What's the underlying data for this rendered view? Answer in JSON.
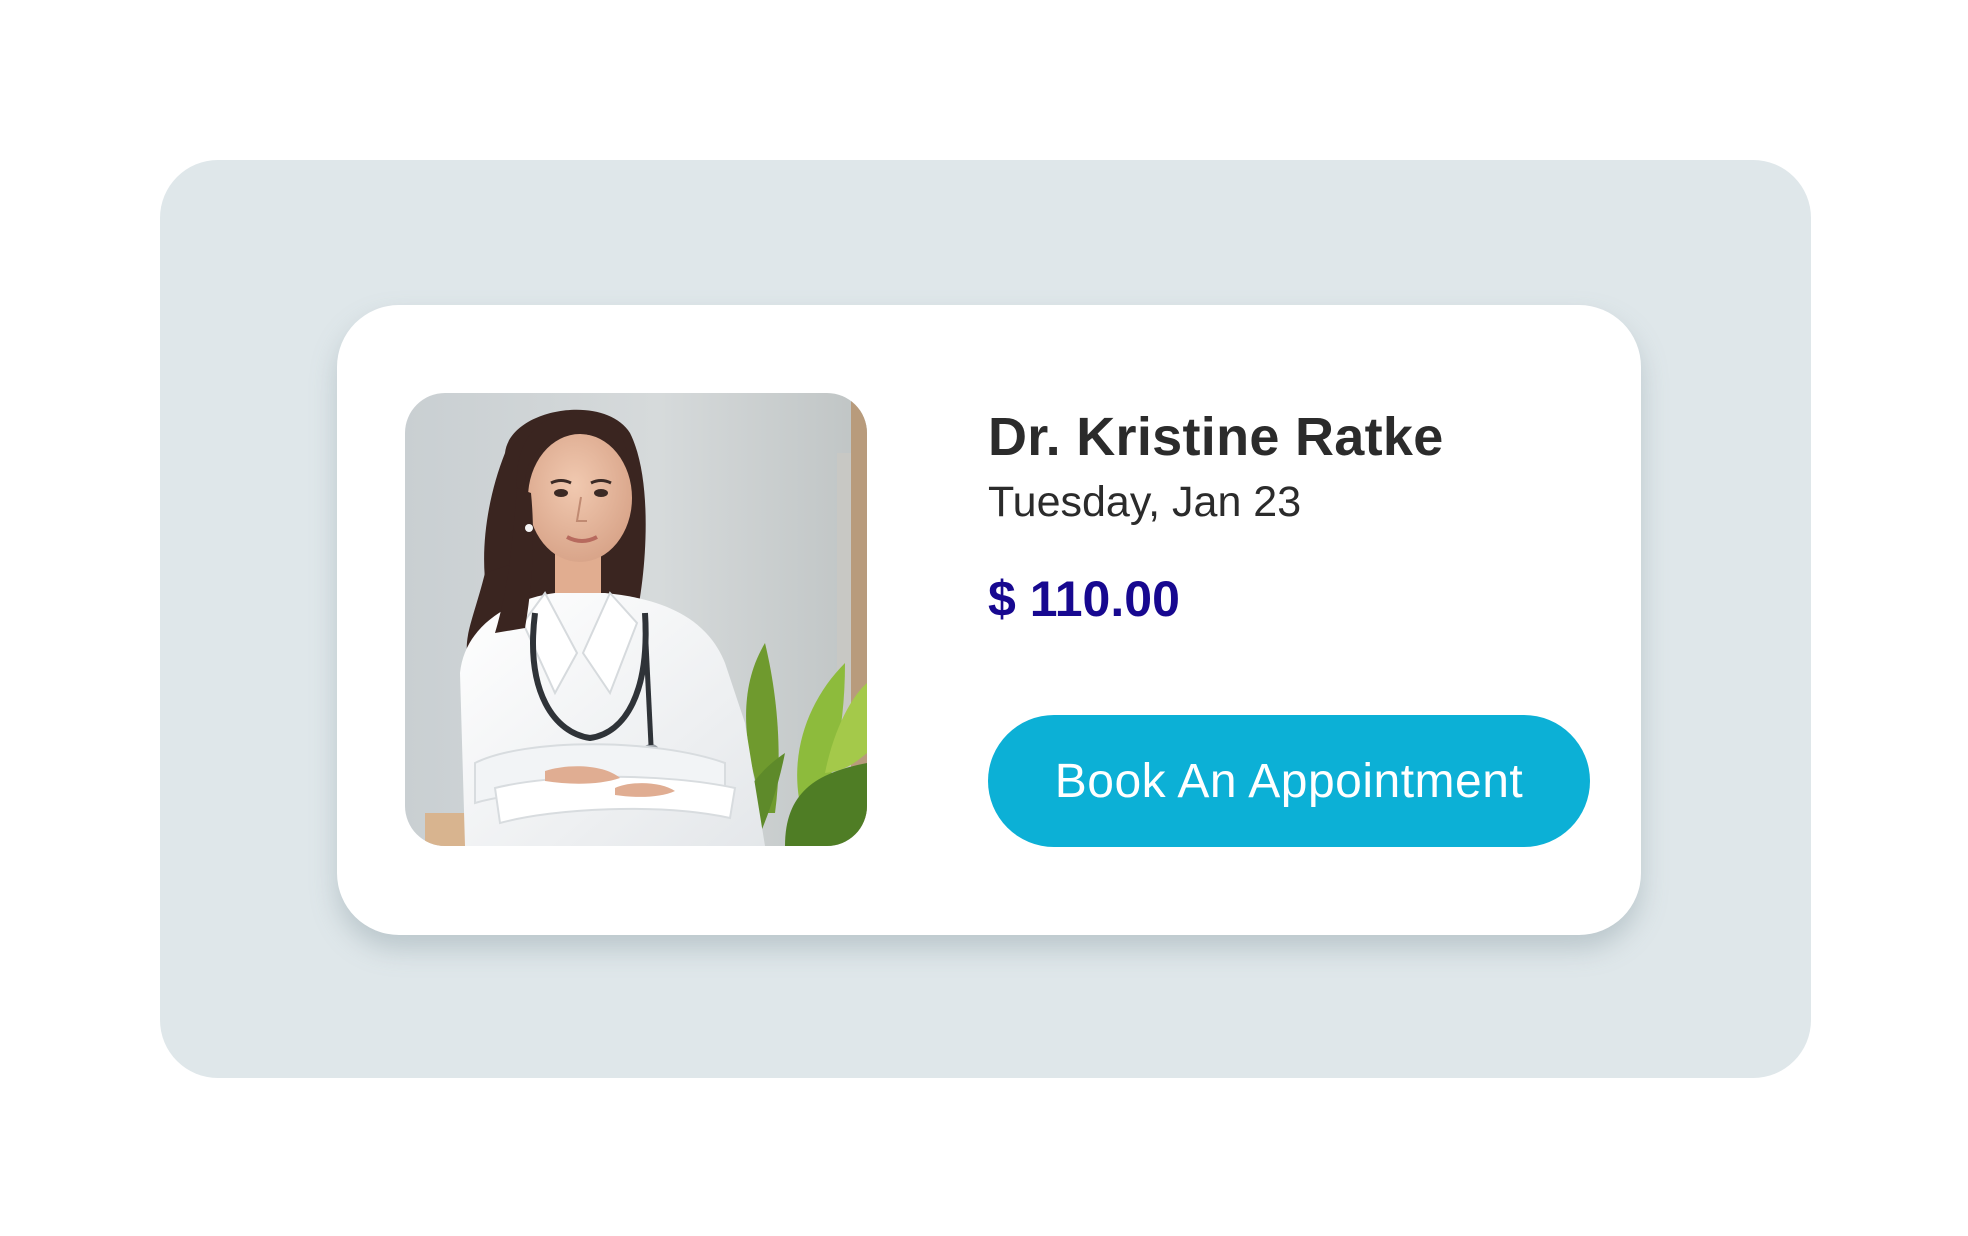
{
  "doctor": {
    "name": "Dr. Kristine Ratke",
    "date": "Tuesday, Jan 23",
    "price": "$ 110.00",
    "photo_icon": "doctor-portrait"
  },
  "actions": {
    "book_label": "Book An Appointment"
  },
  "colors": {
    "backdrop": "#dfe7ea",
    "card": "#ffffff",
    "text": "#2b2b2b",
    "price": "#170890",
    "button": "#0cb0d6",
    "button_text": "#ffffff"
  }
}
